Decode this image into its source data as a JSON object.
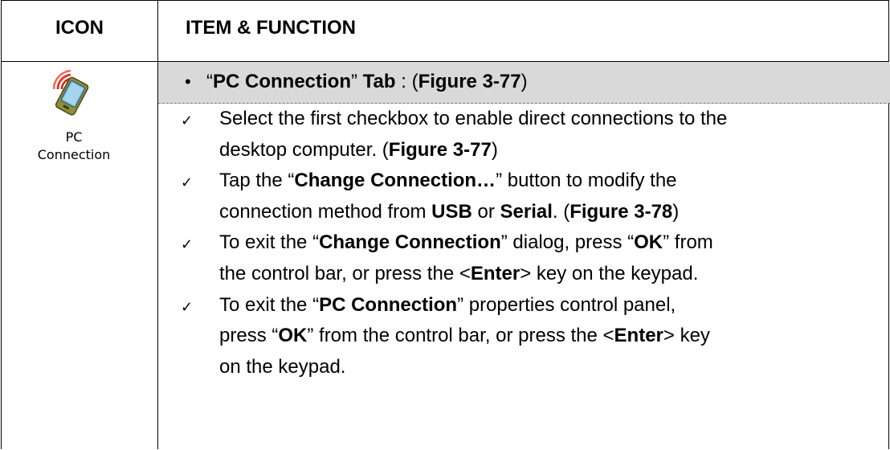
{
  "header": {
    "icon_col": "ICON",
    "item_col": "ITEM & FUNCTION"
  },
  "icon": {
    "name": "pc-connection-icon",
    "label_line1": "PC",
    "label_line2": "Connection"
  },
  "tab": {
    "bullet": "•",
    "open_quote": "“",
    "name": "PC Connection",
    "close_quote": "”",
    "word_tab": " Tab",
    "sep": " : (",
    "figure": "Figure 3-77",
    "close_paren": ")"
  },
  "items": [
    {
      "check": "✓",
      "lines": [
        [
          {
            "t": "Select the first checkbox to enable direct connections to the",
            "b": false
          }
        ],
        [
          {
            "t": "desktop computer. (",
            "b": false
          },
          {
            "t": "Figure 3-77",
            "b": true
          },
          {
            "t": ")",
            "b": false
          }
        ]
      ]
    },
    {
      "check": "✓",
      "lines": [
        [
          {
            "t": "Tap the “",
            "b": false
          },
          {
            "t": "Change Connection…",
            "b": true
          },
          {
            "t": "” button to modify the",
            "b": false
          }
        ],
        [
          {
            "t": "connection method from ",
            "b": false
          },
          {
            "t": "USB",
            "b": true
          },
          {
            "t": " or ",
            "b": false
          },
          {
            "t": "Serial",
            "b": true
          },
          {
            "t": ". (",
            "b": false
          },
          {
            "t": "Figure 3-78",
            "b": true
          },
          {
            "t": ")",
            "b": false
          }
        ]
      ]
    },
    {
      "check": "✓",
      "lines": [
        [
          {
            "t": "To exit the “",
            "b": false
          },
          {
            "t": "Change Connection",
            "b": true
          },
          {
            "t": "” dialog, press “",
            "b": false
          },
          {
            "t": "OK",
            "b": true
          },
          {
            "t": "” from",
            "b": false
          }
        ],
        [
          {
            "t": "the control bar, or press the <",
            "b": false
          },
          {
            "t": "Enter",
            "b": true
          },
          {
            "t": "> key on the keypad.",
            "b": false
          }
        ]
      ]
    },
    {
      "check": "✓",
      "lines": [
        [
          {
            "t": "To exit the “",
            "b": false
          },
          {
            "t": "PC Connection",
            "b": true
          },
          {
            "t": "” properties control panel,",
            "b": false
          }
        ],
        [
          {
            "t": "press “",
            "b": false
          },
          {
            "t": "OK",
            "b": true
          },
          {
            "t": "” from the control bar, or press the <",
            "b": false
          },
          {
            "t": "Enter",
            "b": true
          },
          {
            "t": "> key",
            "b": false
          }
        ],
        [
          {
            "t": "on the keypad.",
            "b": false
          }
        ]
      ]
    }
  ]
}
